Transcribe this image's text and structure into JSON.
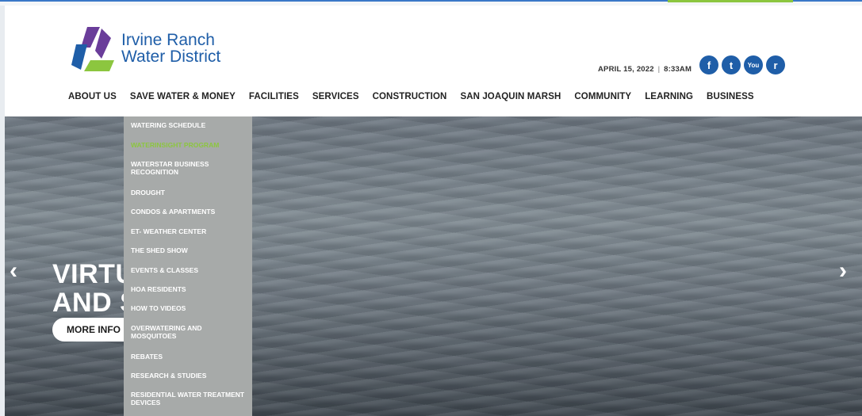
{
  "header": {
    "logo_line1": "Irvine Ranch",
    "logo_line2": "Water District",
    "date": "APRIL 15, 2022",
    "separator": "|",
    "time": "8:33AM",
    "social": [
      {
        "icon": "facebook-icon",
        "glyph": "f"
      },
      {
        "icon": "twitter-icon",
        "glyph": "t"
      },
      {
        "icon": "youtube-icon",
        "glyph": "You"
      },
      {
        "icon": "rss-icon",
        "glyph": "r"
      }
    ]
  },
  "nav": [
    "ABOUT US",
    "SAVE WATER & MONEY",
    "FACILITIES",
    "SERVICES",
    "CONSTRUCTION",
    "SAN JOAQUIN MARSH",
    "COMMUNITY",
    "LEARNING",
    "BUSINESS"
  ],
  "dropdown": {
    "items": [
      {
        "label": "WATERING SCHEDULE"
      },
      {
        "label": "WATERINSIGHT PROGRAM",
        "active": true
      },
      {
        "label": "WATERSTAR BUSINESS RECOGNITION"
      },
      {
        "label": "DROUGHT"
      },
      {
        "label": "CONDOS & APARTMENTS"
      },
      {
        "label": "ET- WEATHER CENTER"
      },
      {
        "label": "THE SHED SHOW"
      },
      {
        "label": "EVENTS & CLASSES"
      },
      {
        "label": "HOA RESIDENTS"
      },
      {
        "label": "HOW TO VIDEOS"
      },
      {
        "label": "OVERWATERING AND MOSQUITOES"
      },
      {
        "label": "REBATES"
      },
      {
        "label": "RESEARCH & STUDIES"
      },
      {
        "label": "RESIDENTIAL WATER TREATMENT DEVICES"
      }
    ]
  },
  "hero": {
    "line1": "VIRTU     NTS",
    "line2": "AND          S",
    "button": "MORE INFO",
    "prev": "‹",
    "next": "›"
  },
  "colors": {
    "brand_blue": "#1f5ea8",
    "brand_green": "#8cc63f",
    "dropdown_bg": "#a7aaa9"
  }
}
